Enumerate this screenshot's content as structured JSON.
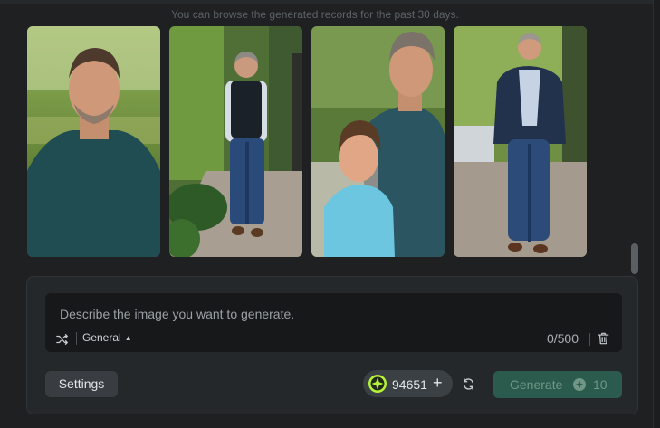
{
  "history_hint": "You can browse the generated records for the past 30 days.",
  "gallery": {
    "images": [
      {
        "name": "result-image-1",
        "subject": "man-portrait-teal-tshirt"
      },
      {
        "name": "result-image-2",
        "subject": "man-walking-vest"
      },
      {
        "name": "result-image-3",
        "subject": "man-with-boy"
      },
      {
        "name": "result-image-4",
        "subject": "man-walking-blazer"
      }
    ]
  },
  "prompt": {
    "value": "",
    "placeholder": "Describe the image you want to generate.",
    "mode_label": "General",
    "counter": "0/500"
  },
  "actions": {
    "settings_label": "Settings",
    "credits_amount": "94651",
    "credits_plus": "+",
    "generate_label": "Generate",
    "generate_cost": "10"
  },
  "icons": {
    "shuffle": "shuffle-icon",
    "trash": "trash-icon",
    "coin": "credit-coin-icon",
    "refresh": "refresh-icon",
    "gem": "credit-cost-icon"
  },
  "colors": {
    "background": "#1e2022",
    "panel": "#25282b",
    "prompt_box": "#16181a",
    "generate_disabled": "#2b5b4c",
    "credit_coin": "#b6f23a"
  }
}
